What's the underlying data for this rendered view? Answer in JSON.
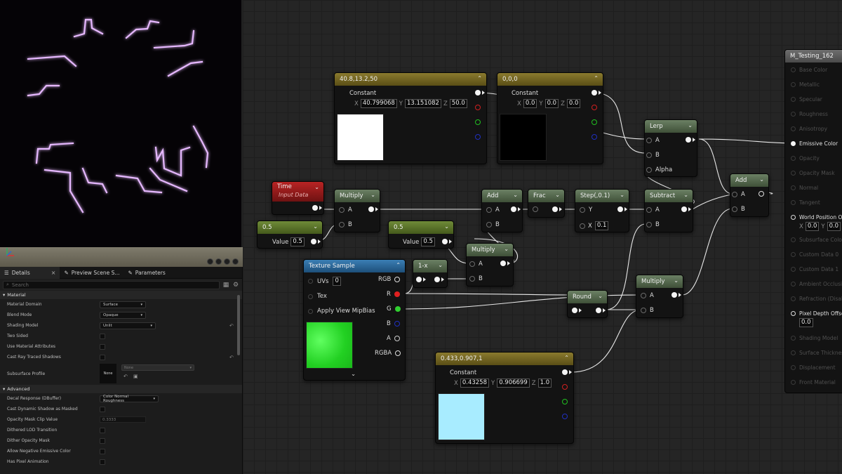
{
  "colors": {
    "pinLinear": "#eeeeee",
    "pinRed": "#e02020",
    "pinGreen": "#30d030",
    "pinBlue": "#2040e0",
    "emissiveGlow": "#d8a0ff"
  },
  "details": {
    "tabs": [
      {
        "label": "Details",
        "icon": "details-icon"
      },
      {
        "label": "Preview Scene S...",
        "icon": "pencil-icon"
      },
      {
        "label": "Parameters",
        "icon": "pencil-icon"
      }
    ],
    "search_placeholder": "Search",
    "material_section": "Material",
    "rows": [
      {
        "label": "Material Domain",
        "type": "dropdown",
        "value": "Surface"
      },
      {
        "label": "Blend Mode",
        "type": "dropdown",
        "value": "Opaque"
      },
      {
        "label": "Shading Model",
        "type": "dropdown",
        "value": "Unlit",
        "reset": true
      },
      {
        "label": "Two Sided",
        "type": "checkbox"
      },
      {
        "label": "Use Material Attributes",
        "type": "checkbox"
      },
      {
        "label": "Cast Ray Traced Shadows",
        "type": "checkbox",
        "reset": true
      }
    ],
    "subsurface": {
      "label": "Subsurface Profile",
      "thumb": "None",
      "dropdown": "None"
    },
    "advanced_section": "Advanced",
    "advanced_rows": [
      {
        "label": "Decal Response (DBuffer)",
        "type": "dropdown",
        "value": "Color Normal Roughness"
      },
      {
        "label": "Cast Dynamic Shadow as Masked",
        "type": "checkbox"
      },
      {
        "label": "Opacity Mask Clip Value",
        "type": "number",
        "value": "0.3333"
      },
      {
        "label": "Dithered LOD Transition",
        "type": "checkbox"
      },
      {
        "label": "Dither Opacity Mask",
        "type": "checkbox"
      },
      {
        "label": "Allow Negative Emissive Color",
        "type": "checkbox"
      },
      {
        "label": "Has Pixel Animation",
        "type": "checkbox"
      }
    ]
  },
  "nodes": {
    "const1": {
      "title": "40.8,13.2,50",
      "label": "Constant",
      "x": "40.799068",
      "y": "13.151082",
      "z": "50.0",
      "swatch": "#ffffff"
    },
    "const2": {
      "title": "0,0,0",
      "label": "Constant",
      "x": "0.0",
      "y": "0.0",
      "z": "0.0",
      "swatch": "#000000"
    },
    "const3": {
      "title": "0.433,0.907,1",
      "label": "Constant",
      "x": "0.43258",
      "y": "0.906699",
      "z": "1.0",
      "swatch": "#a8ecff"
    },
    "time": {
      "title": "Time",
      "sub": "Input Data"
    },
    "scalar1": {
      "title": "0.5",
      "label": "Value",
      "value": "0.5"
    },
    "scalar2": {
      "title": "0.5",
      "label": "Value",
      "value": "0.5"
    },
    "multiply1": {
      "title": "Multiply",
      "a": "A",
      "b": "B"
    },
    "multiply2": {
      "title": "Multiply",
      "a": "A",
      "b": "B"
    },
    "multiply3": {
      "title": "Multiply",
      "a": "A",
      "b": "B"
    },
    "add1": {
      "title": "Add",
      "a": "A",
      "b": "B"
    },
    "add2": {
      "title": "Add",
      "a": "A",
      "b": "B"
    },
    "frac": {
      "title": "Frac"
    },
    "step": {
      "title": "Step(,0.1)",
      "y": "Y",
      "x": "X",
      "xval": "0.1"
    },
    "subtract": {
      "title": "Subtract",
      "a": "A",
      "b": "B"
    },
    "lerp": {
      "title": "Lerp",
      "a": "A",
      "b": "B",
      "alpha": "Alpha"
    },
    "oneminus": {
      "title": "1-x"
    },
    "round": {
      "title": "Round"
    },
    "texture": {
      "title": "Texture Sample",
      "uvs": "UVs",
      "uvs_val": "0",
      "tex": "Tex",
      "mip": "Apply View MipBias",
      "rgb": "RGB",
      "r": "R",
      "g": "G",
      "b": "B",
      "a": "A",
      "rgba": "RGBA",
      "swatch": "#2ee82e"
    }
  },
  "result": {
    "title": "M_Testing_162",
    "pins": [
      "Base Color",
      "Metallic",
      "Specular",
      "Roughness",
      "Anisotropy",
      "Emissive Color",
      "Opacity",
      "Opacity Mask",
      "Normal",
      "Tangent",
      "World Position Offset",
      "Subsurface Color",
      "Custom Data 0",
      "Custom Data 1",
      "Ambient Occlusion",
      "Refraction (Disabled)",
      "Pixel Depth Offset",
      "Shading Model",
      "Surface Thickness",
      "Displacement",
      "Front Material"
    ],
    "active": [
      "Emissive Color",
      "World Position Offset",
      "Pixel Depth Offset"
    ],
    "wpo": {
      "x": "0.0",
      "y": "0.0"
    },
    "pdo": "0.0"
  }
}
